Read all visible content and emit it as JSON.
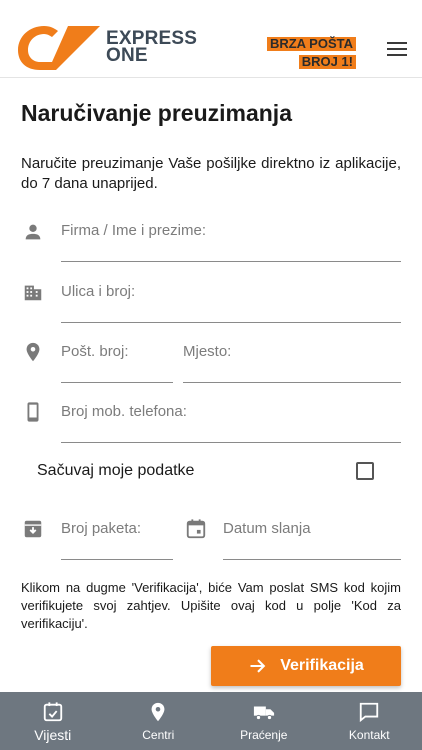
{
  "header": {
    "logo_text_line1": "EXPRESS",
    "logo_text_line2": "ONE",
    "slogan_line1": "BRZA POŠTA",
    "slogan_line2": "BROJ 1!",
    "brand_color": "#f07d1a"
  },
  "page": {
    "title": "Naručivanje preuzimanja",
    "description": "Naručite preuzimanje Vaše pošiljke direktno iz aplikacije, do 7 dana unaprijed."
  },
  "form": {
    "name_placeholder": "Firma / Ime i prezime:",
    "street_placeholder": "Ulica i broj:",
    "postal_placeholder": "Pošt. broj:",
    "city_placeholder": "Mjesto:",
    "phone_placeholder": "Broj mob. telefona:",
    "save_label": "Sačuvaj moje podatke",
    "save_checked": false,
    "packages_placeholder": "Broj paketa:",
    "date_placeholder": "Datum slanja"
  },
  "note": "Klikom na dugme 'Verifikacija', biće Vam poslat SMS kod kojim verifikujete svoj zahtjev. Upišite ovaj kod u polje 'Kod za verifikaciju'.",
  "verify_button": "Verifikacija",
  "nav": {
    "items": [
      {
        "label": "Vijesti",
        "icon": "calendar-check-icon"
      },
      {
        "label": "Centri",
        "icon": "location-pin-icon"
      },
      {
        "label": "Praćenje",
        "icon": "truck-icon"
      },
      {
        "label": "Kontakt",
        "icon": "chat-icon"
      }
    ]
  }
}
